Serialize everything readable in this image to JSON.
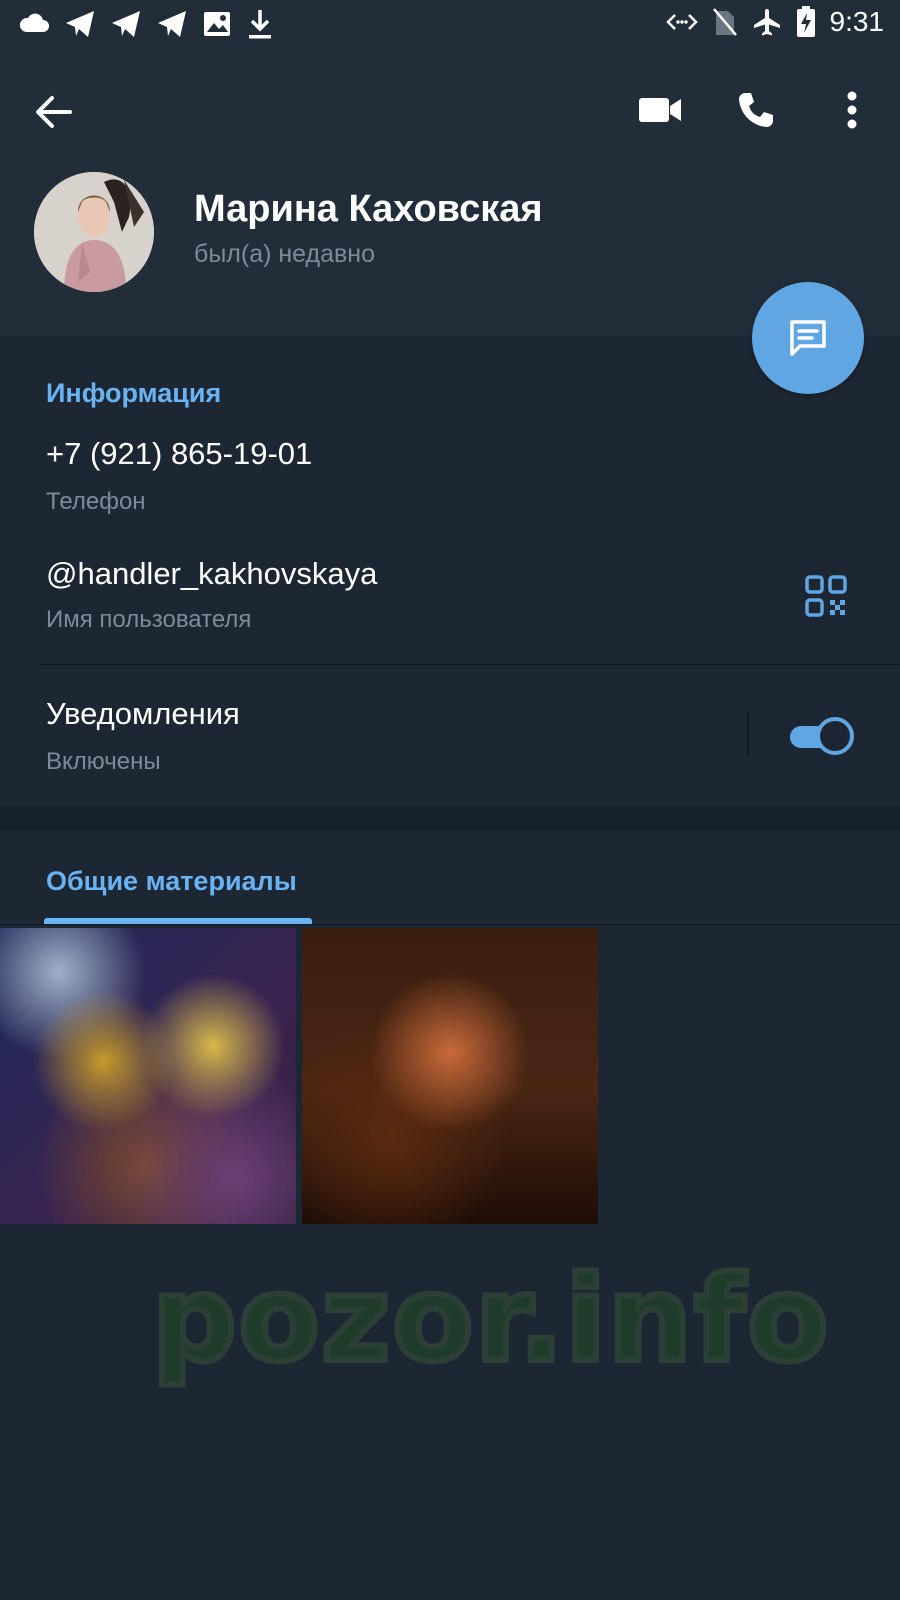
{
  "status_bar": {
    "time": "9:31",
    "left_icons": [
      "cloud-icon",
      "telegram-icon",
      "telegram-icon",
      "telegram-icon",
      "image-icon",
      "download-icon"
    ],
    "right_icons": [
      "data-saver-icon",
      "no-sim-icon",
      "airplane-icon",
      "battery-charging-icon"
    ]
  },
  "toolbar": {
    "back_icon": "arrow-left-icon",
    "video_icon": "video-camera-icon",
    "call_icon": "phone-icon",
    "menu_icon": "more-vert-icon"
  },
  "profile": {
    "name": "Марина Каховская",
    "status": "был(а) недавно"
  },
  "info": {
    "title": "Информация",
    "phone": "+7 (921) 865-19-01",
    "phone_label": "Телефон",
    "username": "@handler_kakhovskaya",
    "username_label": "Имя пользователя",
    "notifications": "Уведомления",
    "notifications_state": "Включены",
    "notifications_enabled": true
  },
  "media": {
    "tab_label": "Общие материалы",
    "thumbnail_count": 2
  },
  "watermark": "pozor.info",
  "colors": {
    "accent": "#6ab3f3",
    "fab": "#5fa6e2",
    "background": "#1d2733",
    "header": "#222d3a",
    "secondary_text": "#7d8b99"
  }
}
